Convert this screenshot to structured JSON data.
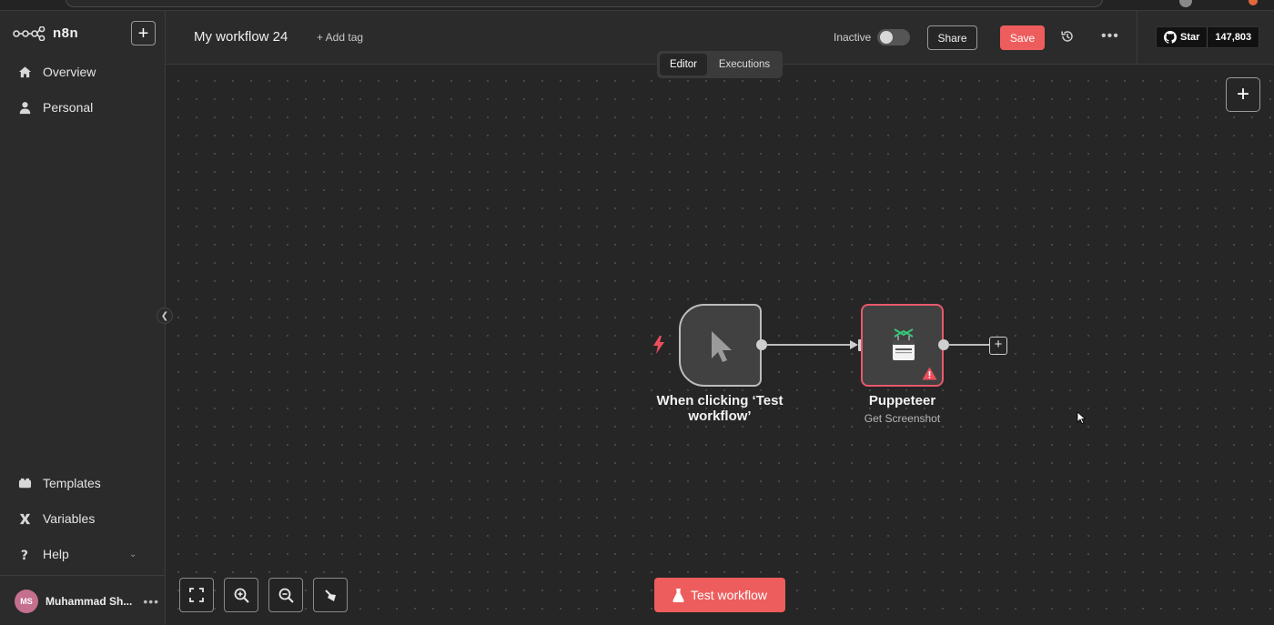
{
  "app": {
    "name": "n8n"
  },
  "sidebar": {
    "logo_text": "n8n",
    "items": [
      {
        "label": "Overview",
        "icon": "home-icon"
      },
      {
        "label": "Personal",
        "icon": "user-icon"
      }
    ],
    "bottom_items": [
      {
        "label": "Templates",
        "icon": "templates-icon"
      },
      {
        "label": "Variables",
        "icon": "variables-icon"
      },
      {
        "label": "Help",
        "icon": "help-icon"
      }
    ],
    "user": {
      "initials": "MS",
      "name": "Muhammad Sh..."
    }
  },
  "header": {
    "workflow_title": "My workflow 24",
    "add_tag": "+ Add tag",
    "status_label": "Inactive",
    "active": false,
    "share_label": "Share",
    "save_label": "Save",
    "github": {
      "star_label": "Star",
      "count": "147,803"
    }
  },
  "tabs": [
    {
      "label": "Editor",
      "active": true
    },
    {
      "label": "Executions",
      "active": false
    }
  ],
  "nodes": [
    {
      "name": "When clicking ‘Test workflow’",
      "type": "manual-trigger",
      "icon": "cursor-icon"
    },
    {
      "name": "Puppeteer",
      "subtitle": "Get Screenshot",
      "icon": "puppeteer-icon",
      "has_warning": true
    }
  ],
  "toolbar": {
    "test_workflow_label": "Test workflow"
  },
  "colors": {
    "accent": "#ee5d5d",
    "canvas_bg": "#262626",
    "sidebar_bg": "#2b2b2b",
    "warning": "#e8596b"
  }
}
